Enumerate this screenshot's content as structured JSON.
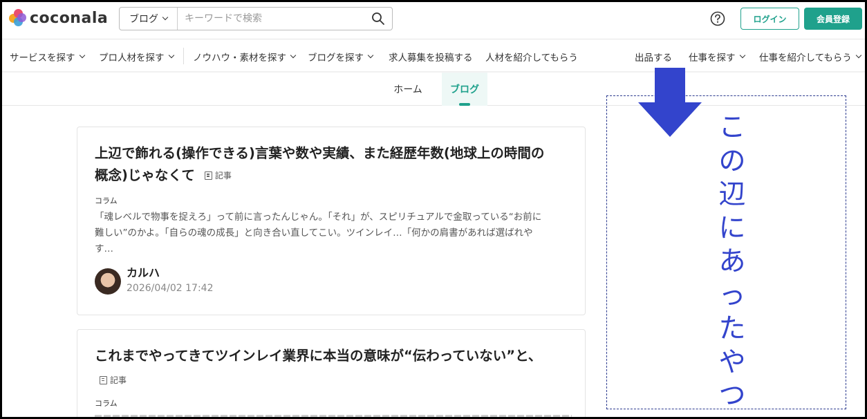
{
  "header": {
    "logo_text": "coconala",
    "search": {
      "category_label": "ブログ",
      "placeholder": "キーワードで検索"
    },
    "login_label": "ログイン",
    "register_label": "会員登録"
  },
  "nav": {
    "items": [
      {
        "label": "サービスを探す"
      },
      {
        "label": "プロ人材を探す"
      },
      {
        "label": "ノウハウ・素材を探す"
      },
      {
        "label": "ブログを探す"
      },
      {
        "label": "求人募集を投稿する"
      },
      {
        "label": "人材を紹介してもらう"
      },
      {
        "label": "出品する"
      },
      {
        "label": "仕事を探す"
      },
      {
        "label": "仕事を紹介してもらう"
      }
    ]
  },
  "tabs": [
    {
      "label": "ホーム"
    },
    {
      "label": "ブログ"
    }
  ],
  "articles": [
    {
      "title_line1": "上辺で飾れる(操作できる)言葉や数や実績、また経歴年数(地球上の時間の",
      "title_line2": "概念)じゃなくて",
      "tag": "記事",
      "category": "コラム",
      "excerpt_line1": "「魂レベルで物事を捉えろ」って前に言ったんじゃん。「それ」が、スピリチュアルで金取っている“お前に",
      "excerpt_line2": "難しい”のかよ。「自らの魂の成長」と向き合い直してこい。ツインレイ…「何かの肩書があれば選ばれや",
      "excerpt_line3": "す…",
      "author": "カルハ",
      "date": "2026/04/02 17:42"
    },
    {
      "title_line1": "これまでやってきてツインレイ業界に本当の意味が“伝わっていない”と、",
      "tag": "記事",
      "category": "コラム"
    }
  ],
  "annotation": {
    "text": "この辺にあったやつ",
    "color": "#3344cc"
  },
  "colors": {
    "brand": "#1fa18c"
  }
}
